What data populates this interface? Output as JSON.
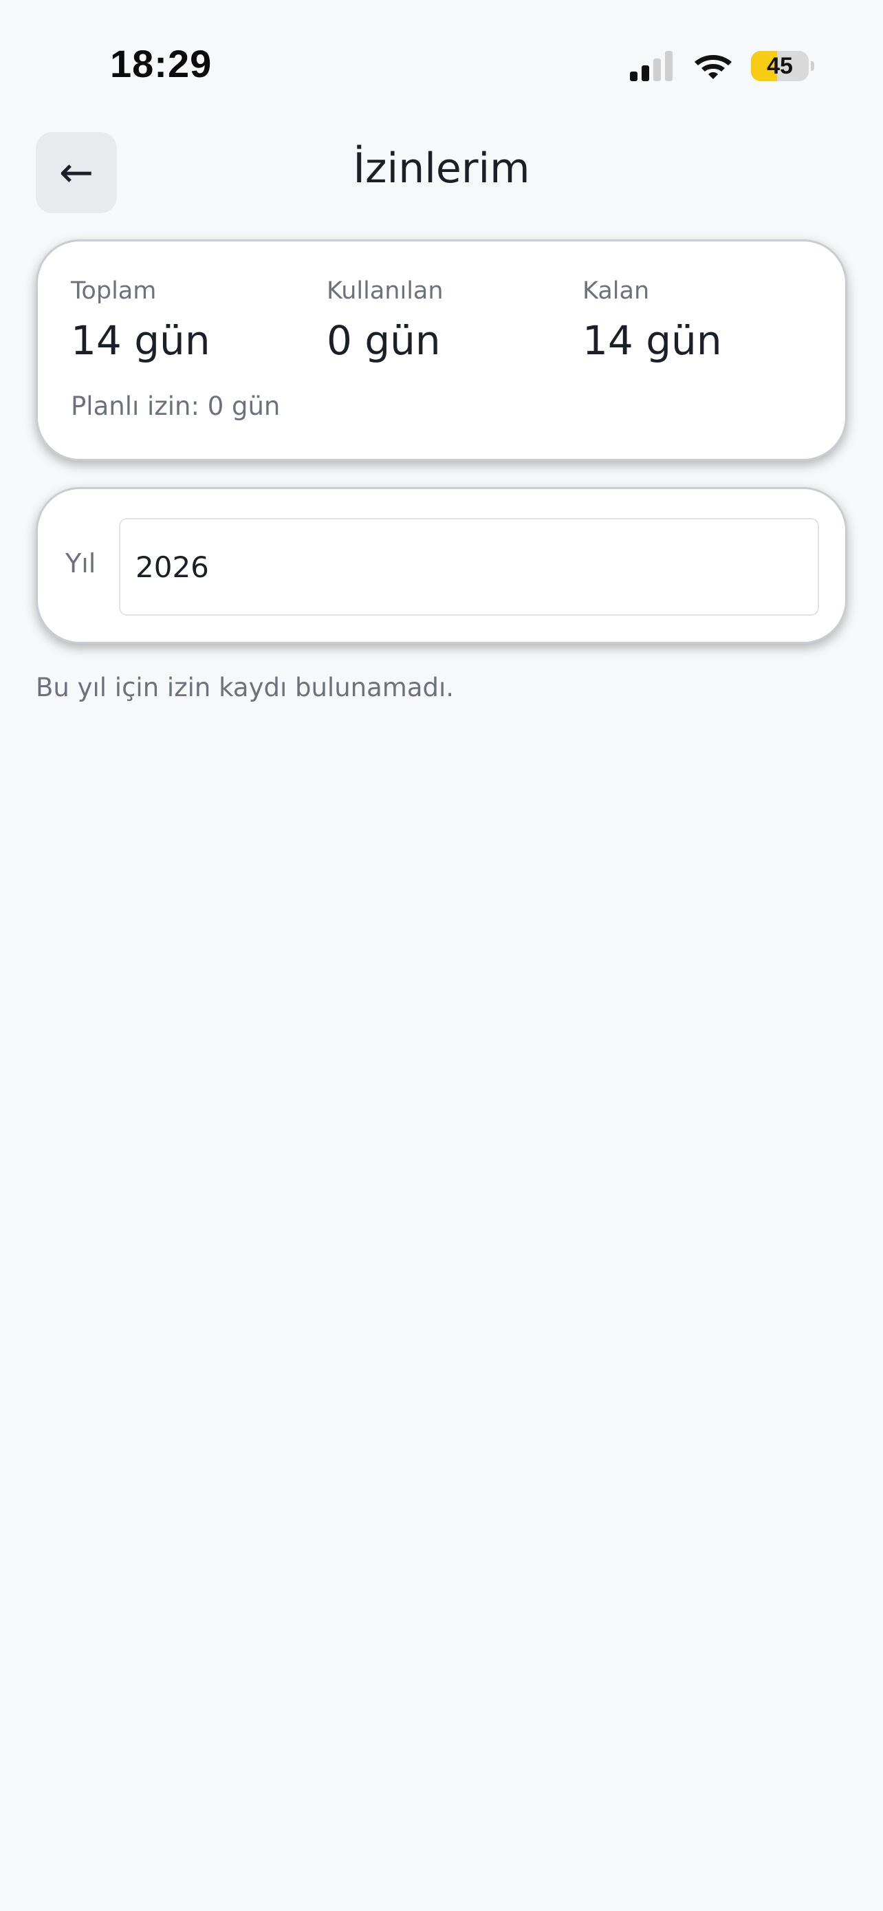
{
  "status_bar": {
    "time": "18:29",
    "battery_level": "45",
    "battery_fraction": 0.45,
    "signal_bars_active": 2,
    "signal_bars_total": 4
  },
  "header": {
    "back_icon": "←",
    "title": "İzinlerim"
  },
  "summary": {
    "total_label": "Toplam",
    "total_value": "14 gün",
    "used_label": "Kullanılan",
    "used_value": "0 gün",
    "remaining_label": "Kalan",
    "remaining_value": "14 gün",
    "planned_text": "Planlı izin: 0 gün"
  },
  "filter": {
    "year_label": "Yıl",
    "year_value": "2026"
  },
  "empty_state": {
    "message": "Bu yıl için izin kaydı bulunamadı."
  },
  "colors": {
    "background": "#f7f8fa",
    "card": "#ffffff",
    "muted_text": "#6c727c",
    "battery_fill": "#f6cd12"
  },
  "icons": {
    "back": "left-arrow-icon",
    "signal": "cellular-signal-icon",
    "wifi": "wifi-icon",
    "battery": "battery-icon"
  }
}
